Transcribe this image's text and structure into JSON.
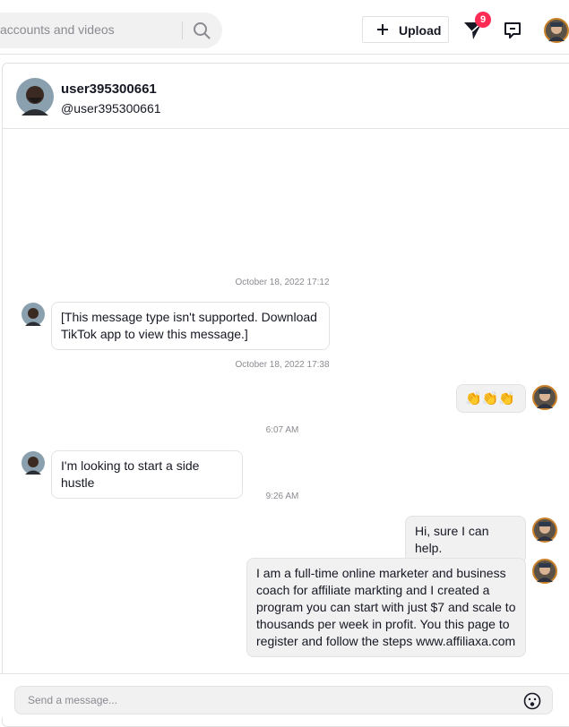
{
  "topbar": {
    "search_placeholder": "accounts and videos",
    "upload_label": "Upload",
    "inbox_badge": "9"
  },
  "chat": {
    "header": {
      "name": "user395300661",
      "handle": "@user395300661"
    },
    "timestamps": [
      "October 18, 2022 17:12",
      "October 18, 2022 17:38",
      "6:07 AM",
      "9:26 AM"
    ],
    "messages": [
      {
        "from": "them",
        "text": "[This message type isn't supported. Download TikTok app to view this message.]"
      },
      {
        "from": "me",
        "text": "👏👏👏"
      },
      {
        "from": "them",
        "text": "I'm looking to start a side hustle"
      },
      {
        "from": "me",
        "text": "Hi, sure I can help."
      },
      {
        "from": "me",
        "text": "I am a full-time online marketer and business coach for affiliate markting and I created a program you can start with just $7 and scale to thousands per week in profit. You this page to register and follow the steps www.affiliaxa.com"
      }
    ],
    "input_placeholder": "Send a message..."
  },
  "colors": {
    "accent": "#fe2c55",
    "bubble_mine": "#f1f1f2",
    "border": "#e3e3e4"
  }
}
